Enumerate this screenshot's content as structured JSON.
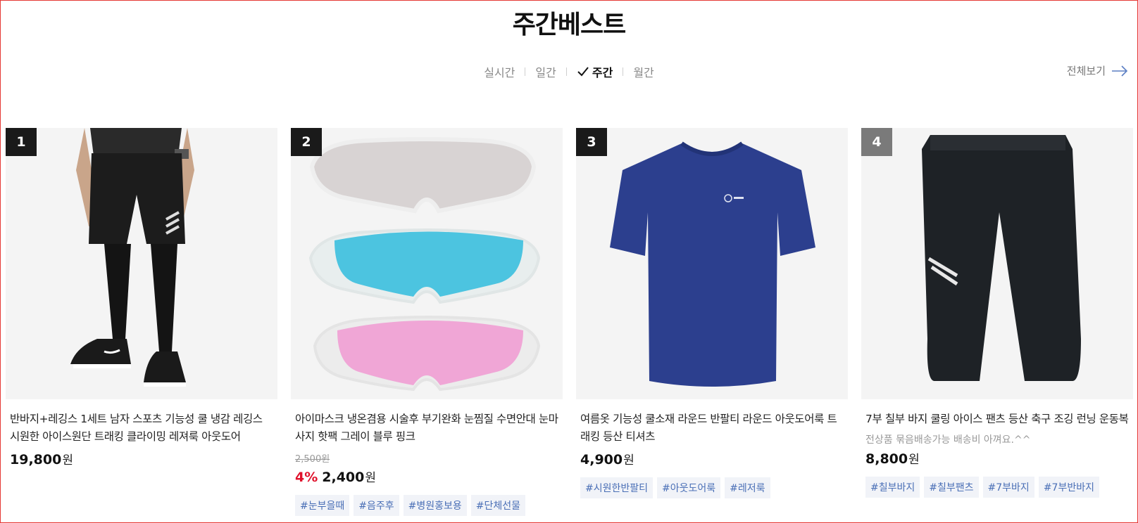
{
  "page": {
    "title": "주간베스트",
    "view_all": "전체보기"
  },
  "tabs": [
    {
      "label": "실시간",
      "active": false
    },
    {
      "label": "일간",
      "active": false
    },
    {
      "label": "주간",
      "active": true
    },
    {
      "label": "월간",
      "active": false
    }
  ],
  "products": [
    {
      "rank": "1",
      "name": "반바지+레깅스 1세트 남자 스포츠 기능성 쿨 냉감 레깅스 시원한 아이스원단 트래킹 클라이밍 레져룩 아웃도어",
      "price": "19,800",
      "currency": "원"
    },
    {
      "rank": "2",
      "name": "아이마스크 냉온겸용 시술후 부기완화 눈찜질 수면안대 눈마사지 핫팩 그레이 블루 핑크",
      "original_price": "2,500원",
      "discount": "4%",
      "price": "2,400",
      "currency": "원",
      "tags": [
        "#눈부을때",
        "#음주후",
        "#병원홍보용",
        "#단체선물"
      ]
    },
    {
      "rank": "3",
      "name": "여름옷 기능성 쿨소재 라운드 반팔티 라운드 아웃도어룩 트래킹 등산 티셔츠",
      "price": "4,900",
      "currency": "원",
      "tags": [
        "#시원한반팔티",
        "#아웃도어룩",
        "#레저룩"
      ]
    },
    {
      "rank": "4",
      "name": "7부 칠부 바지 쿨링 아이스 팬츠 등산 축구 조깅 런닝 운동복",
      "description": "전상품 묶음배송가능 배송비 아껴요.^^",
      "price": "8,800",
      "currency": "원",
      "tags": [
        "#칠부바지",
        "#칠부팬츠",
        "#7부바지",
        "#7부반바지"
      ]
    }
  ],
  "colors": {
    "accent_discount": "#e0112b",
    "tag_text": "#4a6fb6",
    "tag_bg": "#f1f3f8",
    "rank_badge": "#1a1a1a",
    "rank_badge_4": "#7a7a7a"
  }
}
